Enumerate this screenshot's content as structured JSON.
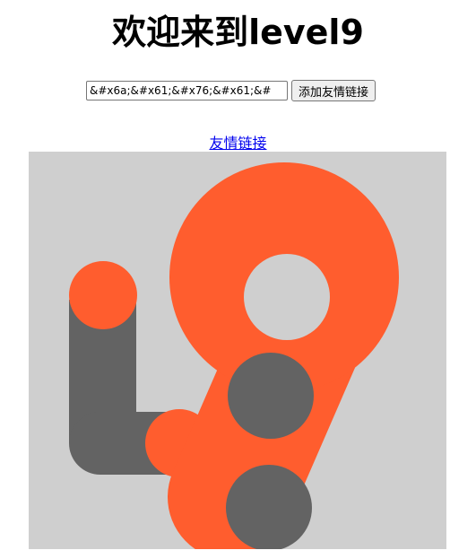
{
  "page": {
    "title": "欢迎来到level9"
  },
  "form": {
    "input_value": "&#x6a;&#x61;&#x76;&#x61;&#",
    "submit_label": "添加友情链接"
  },
  "link": {
    "text": "友情链接"
  },
  "logo": {
    "alt": "level9 logo",
    "colors": {
      "background": "#cfcfcf",
      "orange": "#ff5d2e",
      "gray": "#636363"
    }
  }
}
